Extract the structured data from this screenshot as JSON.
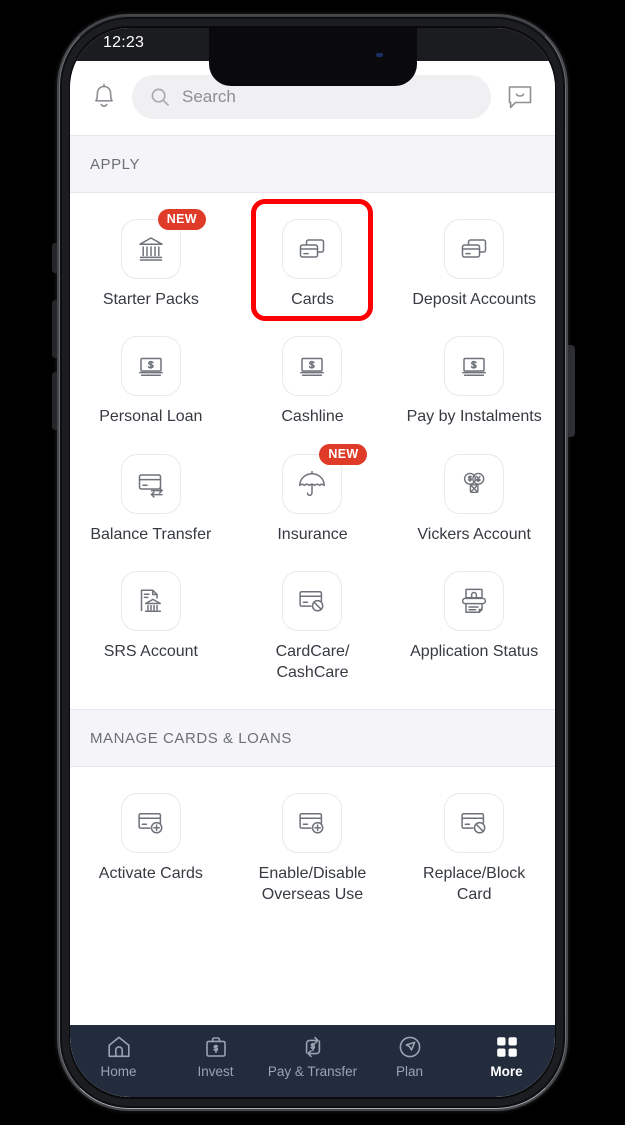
{
  "status_bar": {
    "time": "12:23"
  },
  "top_bar": {
    "notifications_icon": "bell-icon",
    "chat_icon": "chat-bubble-icon",
    "search": {
      "icon": "search-icon",
      "placeholder": "Search",
      "value": ""
    }
  },
  "sections": [
    {
      "title": "APPLY",
      "tiles": [
        {
          "label": "Starter Packs",
          "icon": "bank-building-icon",
          "badge": "NEW",
          "highlighted": false
        },
        {
          "label": "Cards",
          "icon": "credit-cards-icon",
          "badge": null,
          "highlighted": true
        },
        {
          "label": "Deposit Accounts",
          "icon": "credit-cards-icon",
          "badge": null,
          "highlighted": false
        },
        {
          "label": "Personal Loan",
          "icon": "cash-dollar-card-icon",
          "badge": null,
          "highlighted": false
        },
        {
          "label": "Cashline",
          "icon": "cash-dollar-card-icon",
          "badge": null,
          "highlighted": false
        },
        {
          "label": "Pay by Instalments",
          "icon": "cash-dollar-card-icon",
          "badge": null,
          "highlighted": false
        },
        {
          "label": "Balance Transfer",
          "icon": "card-transfer-icon",
          "badge": null,
          "highlighted": false
        },
        {
          "label": "Insurance",
          "icon": "umbrella-icon",
          "badge": "NEW",
          "highlighted": false
        },
        {
          "label": "Vickers Account",
          "icon": "currency-exchange-icon",
          "badge": null,
          "highlighted": false
        },
        {
          "label": "SRS Account",
          "icon": "document-bank-icon",
          "badge": null,
          "highlighted": false
        },
        {
          "label": "CardCare/\nCashCare",
          "icon": "card-blocked-icon",
          "badge": null,
          "highlighted": false
        },
        {
          "label": "Application Status",
          "icon": "printer-document-icon",
          "badge": null,
          "highlighted": false
        }
      ]
    },
    {
      "title": "MANAGE CARDS & LOANS",
      "tiles": [
        {
          "label": "Activate Cards",
          "icon": "card-plus-icon",
          "badge": null,
          "highlighted": false
        },
        {
          "label": "Enable/Disable\nOverseas Use",
          "icon": "card-plus-icon",
          "badge": null,
          "highlighted": false
        },
        {
          "label": "Replace/Block\nCard",
          "icon": "card-blocked-icon",
          "badge": null,
          "highlighted": false
        }
      ]
    }
  ],
  "bottom_nav": {
    "items": [
      {
        "label": "Home",
        "icon": "home-icon",
        "active": false
      },
      {
        "label": "Invest",
        "icon": "briefcase-icon",
        "active": false
      },
      {
        "label": "Pay & Transfer",
        "icon": "transfer-icon",
        "active": false
      },
      {
        "label": "Plan",
        "icon": "compass-icon",
        "active": false
      },
      {
        "label": "More",
        "icon": "grid-icon",
        "active": true
      }
    ]
  },
  "colors": {
    "accent_red": "#e03a28",
    "highlight_red": "#ff0000",
    "nav_background": "#222c3d",
    "section_header_bg": "#f5f5f9",
    "search_bg": "#f0f0f2"
  }
}
